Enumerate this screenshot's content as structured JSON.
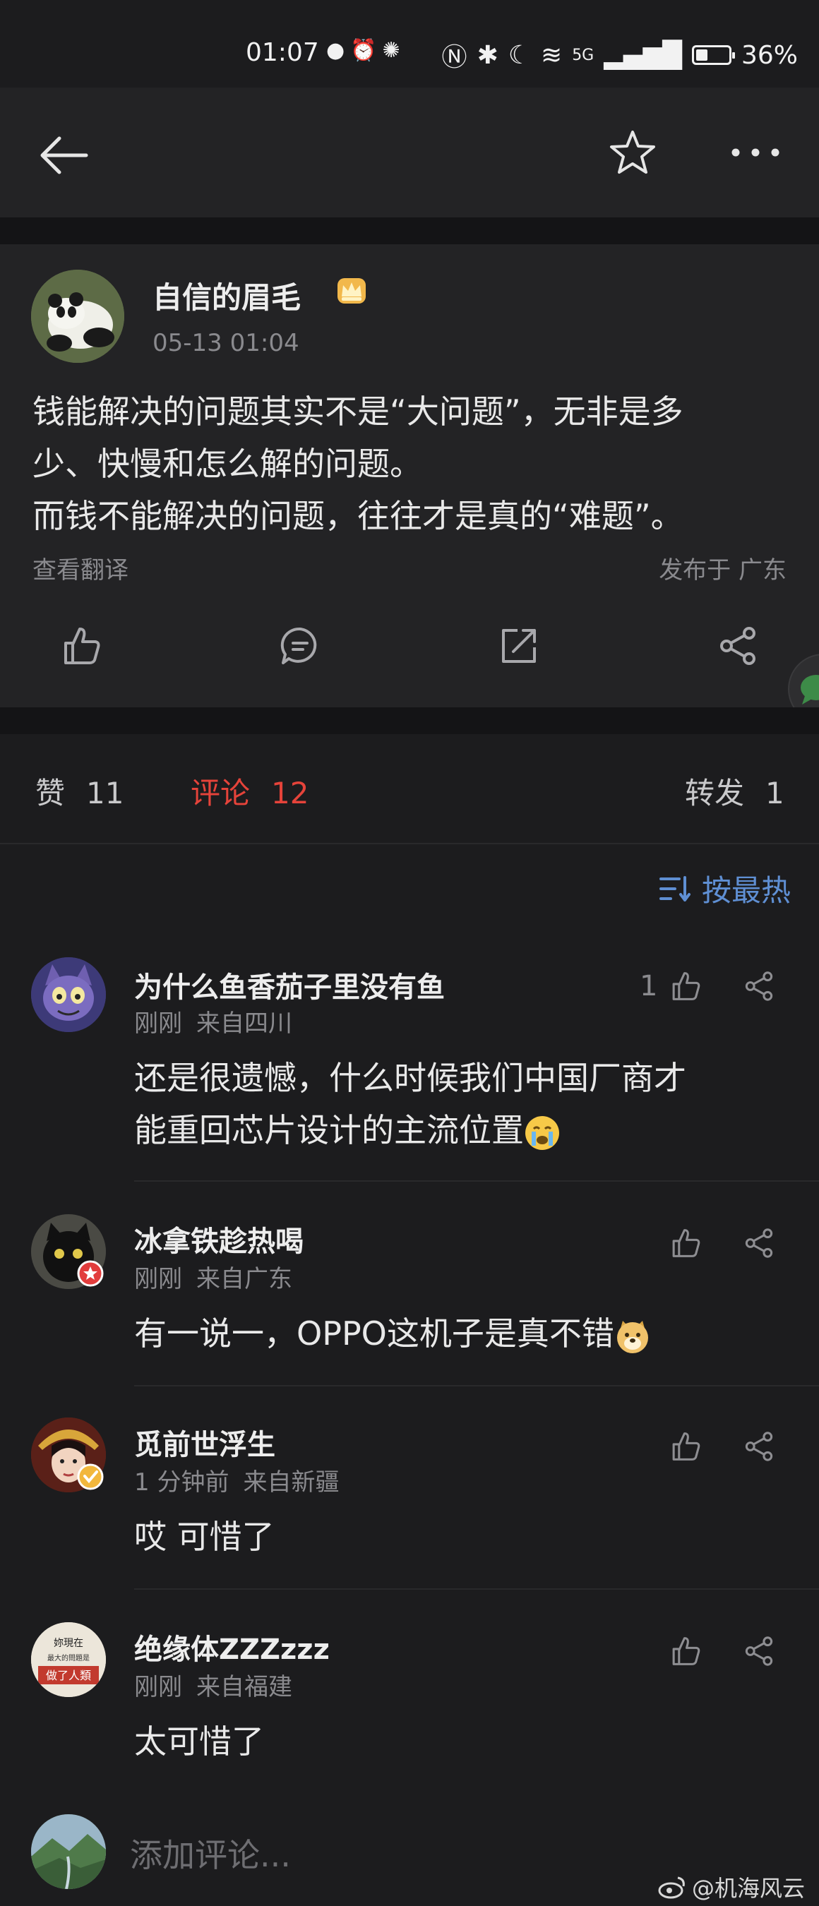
{
  "status_bar": {
    "time": "01:07",
    "network": "5G",
    "battery": "36%",
    "battery_level": 0.36
  },
  "post": {
    "author": "自信的眉毛",
    "time": "05-13 01:04",
    "lines": [
      "钱能解决的问题其实不是“大问题”，无非是多",
      "少、快慢和怎么解的问题。",
      "而钱不能解决的问题，往往才是真的“难题”。"
    ],
    "translate": "查看翻译",
    "region": "发布于 广东"
  },
  "tabs": {
    "likes_label": "赞",
    "likes_count": "11",
    "comments_label": "评论",
    "comments_count": "12",
    "reposts_label": "转发",
    "reposts_count": "1"
  },
  "sort": {
    "label": "按最热"
  },
  "comments": [
    {
      "name": "为什么鱼香茄子里没有鱼",
      "time": "刚刚",
      "from": "来自四川",
      "likes": "1",
      "lines": [
        "还是很遗憾，什么时候我们中国厂商才",
        "能重回芯片设计的主流位置"
      ]
    },
    {
      "name": "冰拿铁趁热喝",
      "time": "刚刚",
      "from": "来自广东",
      "likes": "",
      "lines": [
        "有一说一，OPPO这机子是真不错"
      ]
    },
    {
      "name": "觅前世浮生",
      "time": "1 分钟前",
      "from": "来自新疆",
      "likes": "",
      "lines": [
        "哎 可惜了"
      ]
    },
    {
      "name": "绝缘体ZZZzzz",
      "time": "刚刚",
      "from": "来自福建",
      "likes": "",
      "lines": [
        "太可惜了"
      ],
      "avatar_text": [
        "妳現在",
        "最大的問題是",
        "做了人類"
      ]
    }
  ],
  "bottom": {
    "placeholder": "添加评论...",
    "watermark": "@机海风云"
  }
}
